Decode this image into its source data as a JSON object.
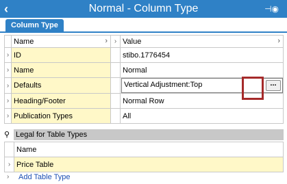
{
  "window": {
    "title": "Normal - Column Type",
    "back_icon": "chevron-left-icon",
    "pin_icon": "pin-icon"
  },
  "tabs": [
    {
      "label": "Column Type",
      "active": true
    }
  ],
  "grid": {
    "headers": {
      "name": "Name",
      "value": "Value"
    },
    "rows": [
      {
        "name": "ID",
        "value": "stibo.1776454"
      },
      {
        "name": "Name",
        "value": "Normal"
      },
      {
        "name": "Defaults",
        "value": "Vertical Adjustment:Top",
        "editing": true
      },
      {
        "name": "Heading/Footer",
        "value": "Normal Row"
      },
      {
        "name": "Publication Types",
        "value": "All"
      }
    ],
    "browse_label": "..."
  },
  "legal": {
    "title": "Legal for Table Types",
    "header": "Name",
    "rows": [
      "Price Table"
    ],
    "add_link": "Add Table Type"
  },
  "colors": {
    "accent": "#2f81c6",
    "row_highlight": "#fff8c8",
    "annotation": "#a52a2a",
    "link": "#1c4fb3"
  }
}
